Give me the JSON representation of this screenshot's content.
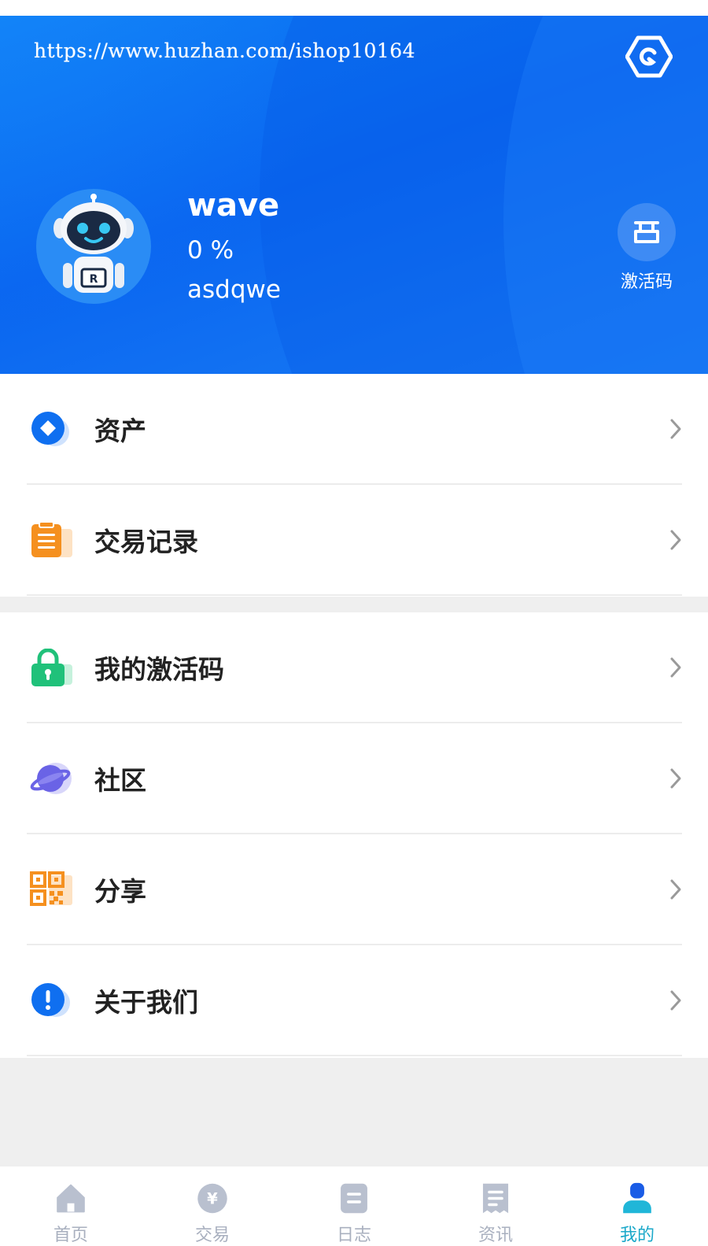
{
  "header": {
    "url_text": "https://www.huzhan.com/ishop10164",
    "username": "wave",
    "percent": "0 %",
    "account": "asdqwe",
    "activate_label": "激活码"
  },
  "menu": {
    "group1": [
      {
        "label": "资产",
        "icon": "assets-icon"
      },
      {
        "label": "交易记录",
        "icon": "clipboard-icon"
      }
    ],
    "group2": [
      {
        "label": "我的激活码",
        "icon": "lock-icon"
      },
      {
        "label": "社区",
        "icon": "planet-icon"
      },
      {
        "label": "分享",
        "icon": "qrcode-icon"
      },
      {
        "label": "关于我们",
        "icon": "info-icon"
      }
    ]
  },
  "tabbar": {
    "tabs": [
      {
        "label": "首页",
        "icon": "home-icon"
      },
      {
        "label": "交易",
        "icon": "yen-icon"
      },
      {
        "label": "日志",
        "icon": "log-icon"
      },
      {
        "label": "资讯",
        "icon": "news-icon"
      },
      {
        "label": "我的",
        "icon": "user-icon"
      }
    ],
    "active_index": 4
  },
  "colors": {
    "header_blue": "#0a6cf0",
    "active_tab": "#1aa8c9",
    "inactive_tab": "#a9b0bf",
    "assets_blue": "#0f6ff0",
    "clipboard_orange": "#f5901f",
    "lock_green": "#20c17a",
    "planet_purple": "#6a63e6",
    "qrcode_orange": "#f5901f",
    "info_blue": "#0f6ff0"
  }
}
